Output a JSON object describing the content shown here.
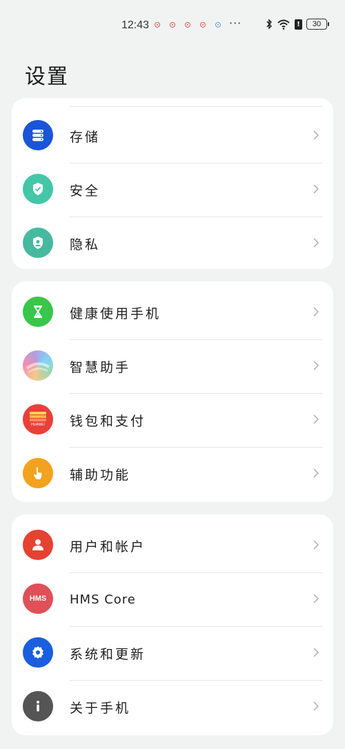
{
  "status_bar": {
    "time": "12:43",
    "more": "···",
    "battery": "30"
  },
  "page": {
    "title": "设置"
  },
  "groups": [
    {
      "items": [
        {
          "label": "存储",
          "icon": "storage-icon",
          "color": "#1a55d8"
        },
        {
          "label": "安全",
          "icon": "shield-icon",
          "color": "#44c6a8"
        },
        {
          "label": "隐私",
          "icon": "privacy-icon",
          "color": "#47b9a0"
        }
      ]
    },
    {
      "items": [
        {
          "label": "健康使用手机",
          "icon": "hourglass-icon",
          "color": "#3ac64a"
        },
        {
          "label": "智慧助手",
          "icon": "assistant-icon",
          "color": "#d49bd8"
        },
        {
          "label": "钱包和支付",
          "icon": "wallet-icon",
          "color": "#e9403a",
          "badge": "HUAWEI"
        },
        {
          "label": "辅助功能",
          "icon": "accessibility-hand-icon",
          "color": "#f2a21e"
        }
      ]
    },
    {
      "items": [
        {
          "label": "用户和帐户",
          "icon": "user-icon",
          "color": "#e64232"
        },
        {
          "label": "HMS Core",
          "icon": "hms-icon",
          "color": "#e05058",
          "badge": "HMS"
        },
        {
          "label": "系统和更新",
          "icon": "gear-icon",
          "color": "#1a5fde"
        },
        {
          "label": "关于手机",
          "icon": "info-icon",
          "color": "#555555"
        }
      ]
    }
  ]
}
